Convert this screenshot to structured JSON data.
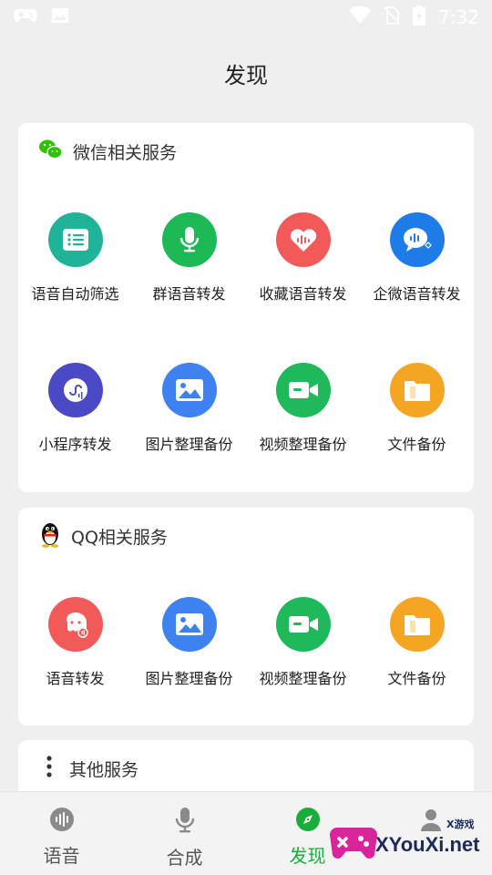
{
  "status_bar": {
    "time": "7:32",
    "icons": [
      "gamepad-icon",
      "image-icon",
      "wifi-icon",
      "no-sim-icon",
      "battery-icon"
    ]
  },
  "header": {
    "title": "发现"
  },
  "wechat": {
    "title": "微信相关服务",
    "icon": "wechat-icon",
    "items": [
      {
        "label": "语音自动筛选",
        "icon": "list-icon",
        "color": "#1fb39a"
      },
      {
        "label": "群语音转发",
        "icon": "microphone-icon",
        "color": "#1db954"
      },
      {
        "label": "收藏语音转发",
        "icon": "heart-icon",
        "color": "#f25a5a"
      },
      {
        "label": "企微语音转发",
        "icon": "work-chat-icon",
        "color": "#1e7ce8"
      },
      {
        "label": "小程序转发",
        "icon": "mini-program-icon",
        "color": "#4b49c6"
      },
      {
        "label": "图片整理备份",
        "icon": "picture-icon",
        "color": "#3d82f0"
      },
      {
        "label": "视频整理备份",
        "icon": "video-icon",
        "color": "#1fb85a"
      },
      {
        "label": "文件备份",
        "icon": "folder-icon",
        "color": "#f4a623"
      }
    ]
  },
  "qq": {
    "title": "QQ相关服务",
    "icon": "qq-penguin-icon",
    "items": [
      {
        "label": "语音转发",
        "icon": "voice-bubble-icon",
        "color": "#f25a5a"
      },
      {
        "label": "图片整理备份",
        "icon": "picture-icon",
        "color": "#3d82f0"
      },
      {
        "label": "视频整理备份",
        "icon": "video-icon",
        "color": "#1fb85a"
      },
      {
        "label": "文件备份",
        "icon": "folder-icon",
        "color": "#f4a623"
      }
    ]
  },
  "other": {
    "title": "其他服务",
    "icon": "more-vertical-icon"
  },
  "bottom_nav": {
    "items": [
      {
        "label": "语音",
        "icon": "voice-wave-icon",
        "active": false
      },
      {
        "label": "合成",
        "icon": "microphone-outline-icon",
        "active": false
      },
      {
        "label": "发现",
        "icon": "compass-icon",
        "active": true
      },
      {
        "label": "",
        "icon": "profile-icon",
        "active": false
      }
    ],
    "active_color": "#1aad3b"
  },
  "watermark": {
    "text": "XYouXi.net",
    "small": "X游戏"
  }
}
